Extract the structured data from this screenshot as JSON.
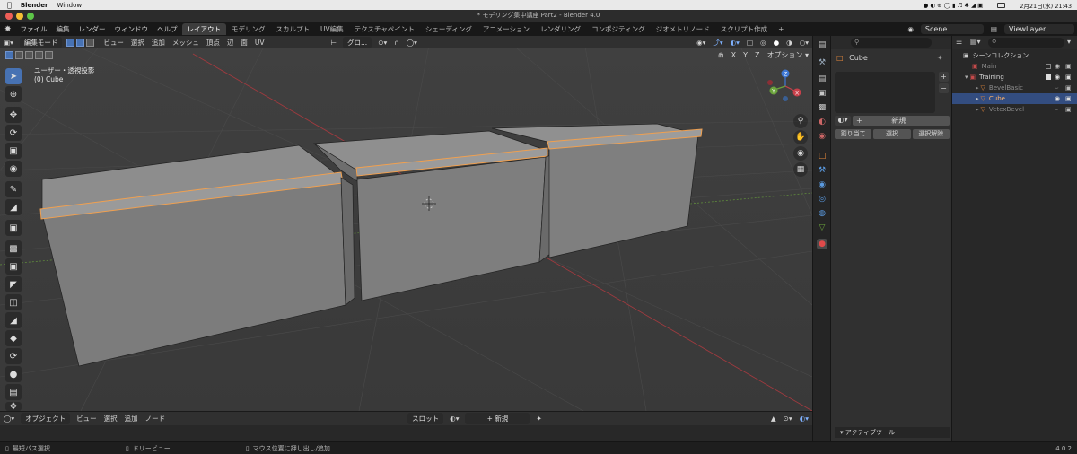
{
  "mac_menu": {
    "app": "Blender",
    "window": "Window",
    "date_time": "2月21日(水) 21:43"
  },
  "window_title": "* モデリング集中講座 Part2 - Blender 4.0",
  "topbar": {
    "menus": [
      "ファイル",
      "編集",
      "レンダー",
      "ウィンドウ",
      "ヘルプ"
    ],
    "workspaces": [
      "レイアウト",
      "モデリング",
      "スカルプト",
      "UV編集",
      "テクスチャペイント",
      "シェーディング",
      "アニメーション",
      "レンダリング",
      "コンポジティング",
      "ジオメトリノード",
      "スクリプト作成"
    ],
    "active_workspace": "レイアウト",
    "add_tab": "+",
    "scene": "Scene",
    "view_layer": "ViewLayer"
  },
  "viewport_header": {
    "mode": "編集モード",
    "menus": [
      "ビュー",
      "選択",
      "追加",
      "メッシュ",
      "頂点",
      "辺",
      "面",
      "UV"
    ],
    "transform_orientation": "グロ...",
    "axes": [
      "X",
      "Y",
      "Z"
    ],
    "options": "オプション"
  },
  "viewport_overlay": {
    "view_name": "ユーザー・透視投影",
    "object_name": "(0) Cube"
  },
  "gizmo_axes": {
    "x": "X",
    "y": "Y",
    "z": "Z"
  },
  "timeline_header": {
    "mode": "オブジェクト",
    "menus": [
      "ビュー",
      "選択",
      "追加",
      "ノード"
    ],
    "slot": "スロット",
    "new": "新規"
  },
  "properties": {
    "object_name": "Cube",
    "new_button": "新規",
    "assign": "割り当て",
    "select": "選択",
    "deselect": "選択解除",
    "active_tool": "アクティブツール"
  },
  "outliner": {
    "root": "シーンコレクション",
    "items": [
      {
        "name": "Main",
        "color": "#c54a4a"
      },
      {
        "name": "Training",
        "color": "#c54a4a"
      },
      {
        "name": "BevelBasic",
        "color": "#e8893b"
      },
      {
        "name": "Cube",
        "color": "#e8893b"
      },
      {
        "name": "VetexBevel",
        "color": "#e8893b"
      }
    ]
  },
  "statusbar": {
    "items": [
      "最短パス選択",
      "ドリービュー",
      "マウス位置に押し出し/追加"
    ],
    "version": "4.0.2"
  },
  "colors": {
    "accent": "#4772b3",
    "selected_edge": "#e8933b",
    "x_axis": "#c8404a",
    "y_axis": "#6ba33c",
    "z_axis": "#3e78d6"
  }
}
